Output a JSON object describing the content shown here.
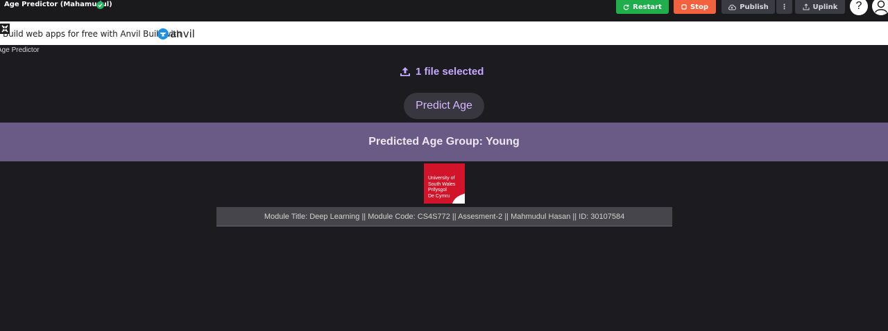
{
  "topbar": {
    "app_title": "Age Predictor (Mahamudul)",
    "restart_label": "Restart",
    "stop_label": "Stop",
    "publish_label": "Publish",
    "more_label": "⋮",
    "uplink_label": "Uplink",
    "help_label": "?"
  },
  "banner": {
    "text": "Build web apps for free with Anvil Built with",
    "logo_text": "anvil"
  },
  "main": {
    "page_label": "Age Predictor",
    "file_status": "1 file selected",
    "predict_button": "Predict Age",
    "result": "Predicted Age Group: Young",
    "university_logo_lines": [
      "University of",
      "South Wales",
      "Prifysgol",
      "De Cymru"
    ],
    "footer": "Module Title: Deep Learning || Module Code: CS4S772 || Assesment-2 || Mahmudul Hasan || ID: 30107584"
  },
  "colors": {
    "accent_purple": "#c6a8ff",
    "result_band": "#6a5a86",
    "restart_green": "#1fae4b",
    "stop_orange": "#f2623e",
    "university_red": "#d2142a"
  }
}
